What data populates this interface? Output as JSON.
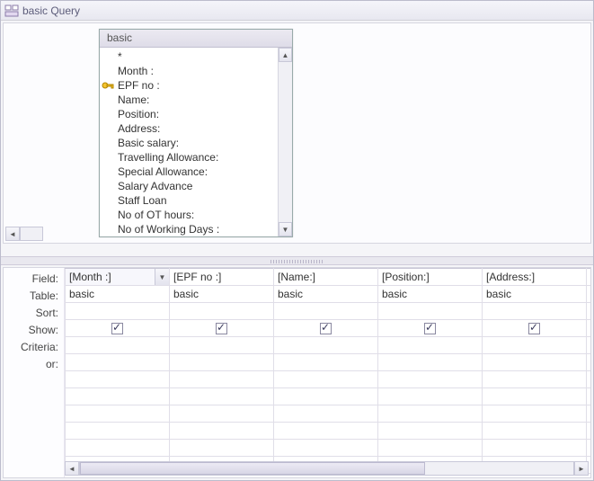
{
  "window": {
    "title": "basic Query"
  },
  "field_table": {
    "name": "basic",
    "fields": [
      "*",
      "Month :",
      "EPF no :",
      "Name:",
      "Position:",
      "Address:",
      "Basic salary:",
      "Travelling Allowance:",
      "Special Allowance:",
      "Salary Advance",
      "Staff Loan",
      "No of OT hours:",
      "No of Working Days :"
    ],
    "primary_key_index": 2
  },
  "qbe": {
    "row_labels": {
      "field": "Field:",
      "table": "Table:",
      "sort": "Sort:",
      "show": "Show:",
      "criteria": "Criteria:",
      "or": "or:"
    },
    "columns": [
      {
        "field": "[Month :]",
        "table": "basic",
        "show": true,
        "active": true
      },
      {
        "field": "[EPF no :]",
        "table": "basic",
        "show": true,
        "active": false
      },
      {
        "field": "[Name:]",
        "table": "basic",
        "show": true,
        "active": false
      },
      {
        "field": "[Position:]",
        "table": "basic",
        "show": true,
        "active": false
      },
      {
        "field": "[Address:]",
        "table": "basic",
        "show": true,
        "active": false
      }
    ],
    "extra_col_preview": {
      "field_initial": "[",
      "table_initial": "b"
    }
  }
}
